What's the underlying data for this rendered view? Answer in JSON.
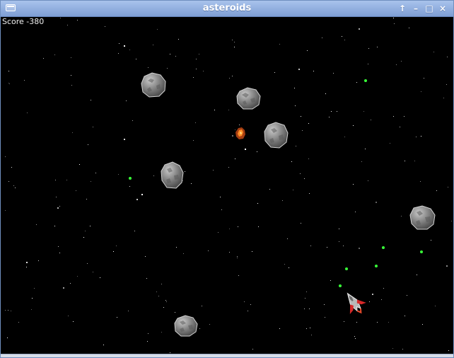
{
  "window": {
    "title": "asteroids",
    "icons": [
      "window-menu-icon",
      "pin-icon",
      "minimize-icon",
      "maximize-icon",
      "close-icon"
    ],
    "controls": {
      "pin": "↑",
      "minimize": "–",
      "maximize": "□",
      "close": "×"
    }
  },
  "game": {
    "score_text": "Score -380",
    "colors": {
      "background": "#000000",
      "stars": "#ffffff",
      "bullets": "#38ff38",
      "asteroid": "#8c8c8c",
      "ship_accent": "#d82828"
    }
  }
}
